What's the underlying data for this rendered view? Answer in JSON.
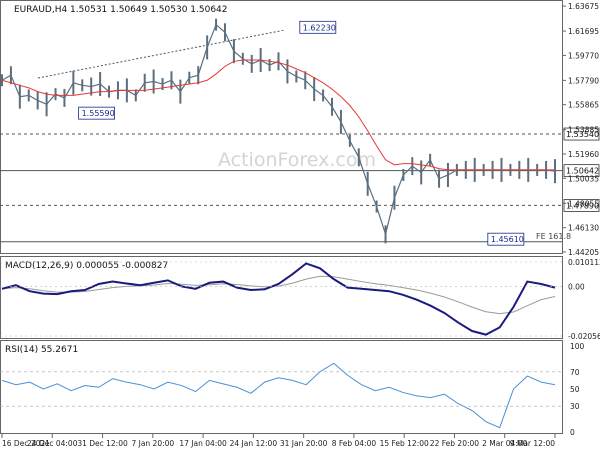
{
  "chart_data": [
    {
      "type": "candlestick",
      "header": "EURAUD,H4  1.50531 1.50649 1.50530 1.50642",
      "watermark": "ActionForex.com",
      "y_ticks": [
        "1.63675",
        "1.61695",
        "1.59770",
        "1.57790",
        "1.55865",
        "1.53885",
        "1.51960",
        "1.50035",
        "1.48055",
        "1.46130",
        "1.44205"
      ],
      "ylim": [
        1.442,
        1.6368
      ],
      "x_ticks": [
        "16 Dec 2021",
        "24 Dec 04:00",
        "31 Dec 12:00",
        "7 Jan 20:00",
        "17 Jan 04:00",
        "24 Jan 12:00",
        "31 Jan 20:00",
        "8 Feb 04:00",
        "15 Feb 12:00",
        "22 Feb 20:00",
        "2 Mar 04:00",
        "9 Mar 12:00"
      ],
      "price_series": {
        "x": [
          0,
          3,
          6,
          9,
          12,
          15,
          18,
          21,
          24,
          27,
          30,
          33,
          36,
          39,
          42,
          45,
          48,
          51,
          54,
          57,
          60,
          63,
          66,
          69,
          72,
          75,
          78,
          81,
          84,
          87,
          90,
          93,
          96,
          99,
          102,
          105,
          108,
          111,
          114,
          117,
          120,
          123,
          126,
          129,
          132,
          135,
          138,
          141,
          144,
          147,
          150,
          153,
          156,
          159,
          162,
          165,
          168,
          171,
          174,
          177,
          180,
          183,
          186
        ],
        "y": [
          1.578,
          1.582,
          1.565,
          1.566,
          1.562,
          1.559,
          1.567,
          1.564,
          1.576,
          1.574,
          1.573,
          1.575,
          1.569,
          1.57,
          1.57,
          1.566,
          1.576,
          1.577,
          1.575,
          1.578,
          1.569,
          1.58,
          1.582,
          1.604,
          1.622,
          1.616,
          1.601,
          1.595,
          1.591,
          1.594,
          1.59,
          1.593,
          1.585,
          1.581,
          1.578,
          1.571,
          1.566,
          1.557,
          1.545,
          1.53,
          1.517,
          1.496,
          1.478,
          1.456,
          1.485,
          1.503,
          1.51,
          1.505,
          1.515,
          1.5,
          1.503,
          1.507,
          1.507,
          1.507,
          1.507,
          1.507,
          1.507,
          1.507,
          1.507,
          1.507,
          1.507,
          1.507,
          1.506
        ],
        "ma": [
          1.578,
          1.576,
          1.574,
          1.572,
          1.569,
          1.567,
          1.566,
          1.566,
          1.566,
          1.567,
          1.568,
          1.569,
          1.569,
          1.57,
          1.57,
          1.57,
          1.57,
          1.571,
          1.572,
          1.573,
          1.574,
          1.575,
          1.576,
          1.578,
          1.583,
          1.589,
          1.593,
          1.594,
          1.594,
          1.594,
          1.593,
          1.592,
          1.59,
          1.587,
          1.584,
          1.58,
          1.576,
          1.571,
          1.565,
          1.558,
          1.549,
          1.538,
          1.526,
          1.515,
          1.511,
          1.512,
          1.512,
          1.511,
          1.51,
          1.508,
          1.507,
          1.507,
          1.507,
          1.507,
          1.507,
          1.507,
          1.507,
          1.507,
          1.507,
          1.507,
          1.507,
          1.507,
          1.507
        ]
      },
      "levels": [
        {
          "label": "1.53540",
          "value": 1.5354,
          "style": "dashed"
        },
        {
          "label": "1.50642",
          "value": 1.50642,
          "style": "solid"
        },
        {
          "label": "1.47890",
          "value": 1.4789,
          "style": "dashed"
        },
        {
          "label": "FE 161.8",
          "value": 1.4501,
          "style": "solid"
        }
      ],
      "annotations": [
        {
          "label": "1.62230",
          "value": 1.6223
        },
        {
          "label": "1.55590",
          "value": 1.5559
        },
        {
          "label": "1.45610",
          "value": 1.4561
        }
      ],
      "colors": {
        "price": "#5b6e7e",
        "ma": "#e53935",
        "level": "#555555",
        "trend": "#555555"
      }
    },
    {
      "type": "line",
      "title": "MACD(12,26,9) 0.000055 -0.000827",
      "y_ticks": [
        "0.010113",
        "0.00",
        "-0.020561"
      ],
      "ylim": [
        -0.02056,
        0.01011
      ],
      "macd": [
        -0.001,
        0.0005,
        -0.002,
        -0.003,
        -0.0032,
        -0.002,
        -0.0015,
        0.001,
        0.002,
        0.0012,
        0.0005,
        0.0015,
        0.0025,
        0.0,
        -0.001,
        0.0015,
        0.002,
        -0.0005,
        -0.0015,
        -0.0012,
        0.001,
        0.005,
        0.0095,
        0.0075,
        0.003,
        -0.0005,
        -0.001,
        -0.0015,
        -0.002,
        -0.0035,
        -0.0055,
        -0.008,
        -0.011,
        -0.015,
        -0.0185,
        -0.02,
        -0.017,
        -0.0085,
        0.002,
        0.001,
        -0.0005
      ],
      "signal": [
        -0.001,
        -0.0005,
        -0.001,
        -0.0018,
        -0.0024,
        -0.0024,
        -0.0021,
        -0.0013,
        -0.0005,
        0.0,
        0.0002,
        0.0006,
        0.0012,
        0.0009,
        0.0004,
        0.0007,
        0.0011,
        0.0008,
        0.0002,
        -0.0002,
        0.0001,
        0.0013,
        0.003,
        0.0042,
        0.004,
        0.003,
        0.002,
        0.0011,
        0.0004,
        -0.0005,
        -0.0015,
        -0.0028,
        -0.0044,
        -0.0064,
        -0.0086,
        -0.0105,
        -0.0113,
        -0.0106,
        -0.008,
        -0.0055,
        -0.0042
      ],
      "colors": {
        "macd": "#1a1a80",
        "signal": "#9a9a9a"
      }
    },
    {
      "type": "line",
      "title": "RSI(14) 55.2671",
      "y_ticks": [
        "100",
        "70",
        "50",
        "30",
        "0"
      ],
      "ylim": [
        0,
        100
      ],
      "rsi": [
        60,
        55,
        58,
        50,
        56,
        48,
        54,
        52,
        62,
        58,
        55,
        50,
        58,
        54,
        47,
        60,
        56,
        52,
        45,
        58,
        63,
        60,
        55,
        70,
        80,
        66,
        55,
        48,
        52,
        46,
        42,
        40,
        44,
        33,
        25,
        12,
        5,
        50,
        65,
        58,
        55
      ],
      "colors": {
        "rsi": "#4a90d9"
      }
    }
  ]
}
